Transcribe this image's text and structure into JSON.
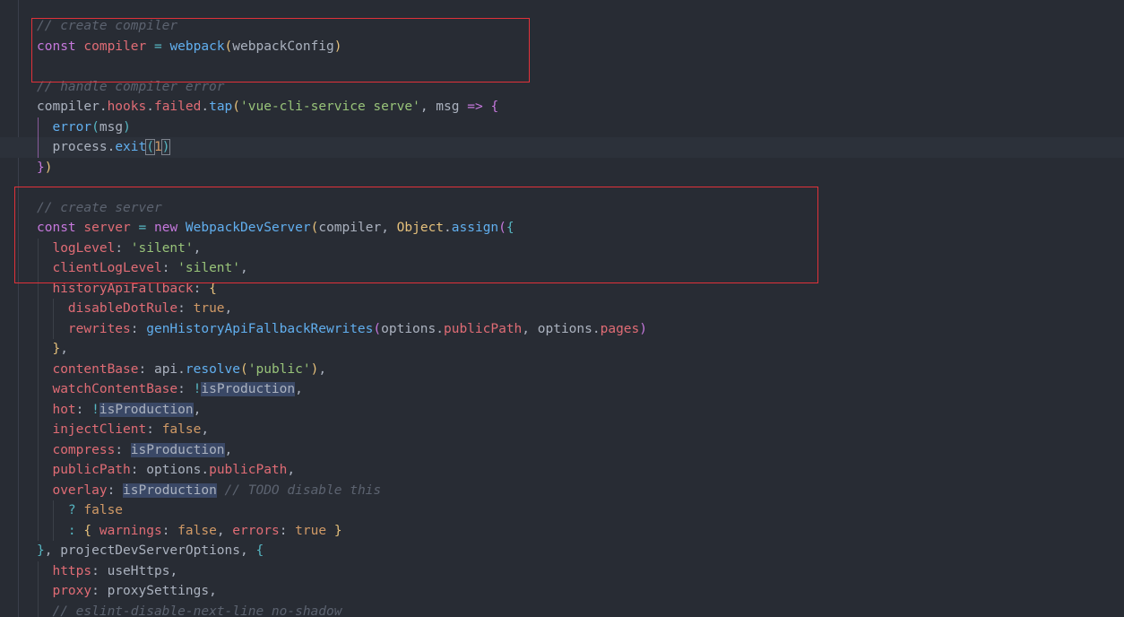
{
  "editor": {
    "lines": [
      {
        "t": [
          {
            "c": "cm",
            "v": "// create compiler"
          }
        ]
      },
      {
        "t": [
          {
            "c": "kw",
            "v": "const"
          },
          {
            "c": "pn",
            "v": " "
          },
          {
            "c": "vr",
            "v": "compiler"
          },
          {
            "c": "pn",
            "v": " "
          },
          {
            "c": "op",
            "v": "="
          },
          {
            "c": "pn",
            "v": " "
          },
          {
            "c": "fn",
            "v": "webpack"
          },
          {
            "c": "br1",
            "v": "("
          },
          {
            "c": "pn",
            "v": "webpackConfig"
          },
          {
            "c": "br1",
            "v": ")"
          }
        ]
      },
      {
        "t": []
      },
      {
        "t": [
          {
            "c": "cm",
            "v": "// handle compiler error"
          }
        ]
      },
      {
        "t": [
          {
            "c": "pn",
            "v": "compiler"
          },
          {
            "c": "pn",
            "v": "."
          },
          {
            "c": "vr",
            "v": "hooks"
          },
          {
            "c": "pn",
            "v": "."
          },
          {
            "c": "vr",
            "v": "failed"
          },
          {
            "c": "pn",
            "v": "."
          },
          {
            "c": "fn",
            "v": "tap"
          },
          {
            "c": "br1",
            "v": "("
          },
          {
            "c": "st",
            "v": "'vue-cli-service serve'"
          },
          {
            "c": "pn",
            "v": ", "
          },
          {
            "c": "pn",
            "v": "msg"
          },
          {
            "c": "pn",
            "v": " "
          },
          {
            "c": "kw",
            "v": "=>"
          },
          {
            "c": "pn",
            "v": " "
          },
          {
            "c": "br2",
            "v": "{"
          }
        ]
      },
      {
        "indent": 1,
        "t": [
          {
            "c": "fn",
            "v": "error"
          },
          {
            "c": "br3",
            "v": "("
          },
          {
            "c": "pn",
            "v": "msg"
          },
          {
            "c": "br3",
            "v": ")"
          }
        ]
      },
      {
        "indent": 1,
        "current": true,
        "t": [
          {
            "c": "pn",
            "v": "process"
          },
          {
            "c": "pn",
            "v": "."
          },
          {
            "c": "fn",
            "v": "exit"
          },
          {
            "c": "br3",
            "v": "("
          },
          {
            "c": "num",
            "v": "1"
          },
          {
            "c": "br3",
            "v": ")"
          }
        ]
      },
      {
        "t": [
          {
            "c": "br2",
            "v": "}"
          },
          {
            "c": "br1",
            "v": ")"
          }
        ]
      },
      {
        "t": []
      },
      {
        "t": [
          {
            "c": "cm",
            "v": "// create server"
          }
        ]
      },
      {
        "t": [
          {
            "c": "kw",
            "v": "const"
          },
          {
            "c": "pn",
            "v": " "
          },
          {
            "c": "vr",
            "v": "server"
          },
          {
            "c": "pn",
            "v": " "
          },
          {
            "c": "op",
            "v": "="
          },
          {
            "c": "pn",
            "v": " "
          },
          {
            "c": "kw",
            "v": "new"
          },
          {
            "c": "pn",
            "v": " "
          },
          {
            "c": "fn",
            "v": "WebpackDevServer"
          },
          {
            "c": "br1",
            "v": "("
          },
          {
            "c": "pn",
            "v": "compiler"
          },
          {
            "c": "pn",
            "v": ", "
          },
          {
            "c": "cl",
            "v": "Object"
          },
          {
            "c": "pn",
            "v": "."
          },
          {
            "c": "fn",
            "v": "assign"
          },
          {
            "c": "br2",
            "v": "("
          },
          {
            "c": "br3",
            "v": "{"
          }
        ]
      },
      {
        "indent": 1,
        "t": [
          {
            "c": "vr",
            "v": "logLevel"
          },
          {
            "c": "pn",
            "v": ": "
          },
          {
            "c": "st",
            "v": "'silent'"
          },
          {
            "c": "pn",
            "v": ","
          }
        ]
      },
      {
        "indent": 1,
        "t": [
          {
            "c": "vr",
            "v": "clientLogLevel"
          },
          {
            "c": "pn",
            "v": ": "
          },
          {
            "c": "st",
            "v": "'silent'"
          },
          {
            "c": "pn",
            "v": ","
          }
        ]
      },
      {
        "indent": 1,
        "t": [
          {
            "c": "vr",
            "v": "historyApiFallback"
          },
          {
            "c": "pn",
            "v": ": "
          },
          {
            "c": "br1",
            "v": "{"
          }
        ]
      },
      {
        "indent": 2,
        "t": [
          {
            "c": "vr",
            "v": "disableDotRule"
          },
          {
            "c": "pn",
            "v": ": "
          },
          {
            "c": "bool",
            "v": "true"
          },
          {
            "c": "pn",
            "v": ","
          }
        ]
      },
      {
        "indent": 2,
        "t": [
          {
            "c": "vr",
            "v": "rewrites"
          },
          {
            "c": "pn",
            "v": ": "
          },
          {
            "c": "fn",
            "v": "genHistoryApiFallbackRewrites"
          },
          {
            "c": "br2",
            "v": "("
          },
          {
            "c": "pn",
            "v": "options"
          },
          {
            "c": "pn",
            "v": "."
          },
          {
            "c": "vr",
            "v": "publicPath"
          },
          {
            "c": "pn",
            "v": ", "
          },
          {
            "c": "pn",
            "v": "options"
          },
          {
            "c": "pn",
            "v": "."
          },
          {
            "c": "vr",
            "v": "pages"
          },
          {
            "c": "br2",
            "v": ")"
          }
        ]
      },
      {
        "indent": 1,
        "t": [
          {
            "c": "br1",
            "v": "}"
          },
          {
            "c": "pn",
            "v": ","
          }
        ]
      },
      {
        "indent": 1,
        "t": [
          {
            "c": "vr",
            "v": "contentBase"
          },
          {
            "c": "pn",
            "v": ": "
          },
          {
            "c": "pn",
            "v": "api"
          },
          {
            "c": "pn",
            "v": "."
          },
          {
            "c": "fn",
            "v": "resolve"
          },
          {
            "c": "br1",
            "v": "("
          },
          {
            "c": "st",
            "v": "'public'"
          },
          {
            "c": "br1",
            "v": ")"
          },
          {
            "c": "pn",
            "v": ","
          }
        ]
      },
      {
        "indent": 1,
        "t": [
          {
            "c": "vr",
            "v": "watchContentBase"
          },
          {
            "c": "pn",
            "v": ": "
          },
          {
            "c": "op",
            "v": "!"
          },
          {
            "c": "pn hl",
            "v": "isProduction"
          },
          {
            "c": "pn",
            "v": ","
          }
        ]
      },
      {
        "indent": 1,
        "t": [
          {
            "c": "vr",
            "v": "hot"
          },
          {
            "c": "pn",
            "v": ": "
          },
          {
            "c": "op",
            "v": "!"
          },
          {
            "c": "pn hl",
            "v": "isProduction"
          },
          {
            "c": "pn",
            "v": ","
          }
        ]
      },
      {
        "indent": 1,
        "t": [
          {
            "c": "vr",
            "v": "injectClient"
          },
          {
            "c": "pn",
            "v": ": "
          },
          {
            "c": "bool",
            "v": "false"
          },
          {
            "c": "pn",
            "v": ","
          }
        ]
      },
      {
        "indent": 1,
        "t": [
          {
            "c": "vr",
            "v": "compress"
          },
          {
            "c": "pn",
            "v": ": "
          },
          {
            "c": "pn hl",
            "v": "isProduction"
          },
          {
            "c": "pn",
            "v": ","
          }
        ]
      },
      {
        "indent": 1,
        "t": [
          {
            "c": "vr",
            "v": "publicPath"
          },
          {
            "c": "pn",
            "v": ": "
          },
          {
            "c": "pn",
            "v": "options"
          },
          {
            "c": "pn",
            "v": "."
          },
          {
            "c": "vr",
            "v": "publicPath"
          },
          {
            "c": "pn",
            "v": ","
          }
        ]
      },
      {
        "indent": 1,
        "t": [
          {
            "c": "vr",
            "v": "overlay"
          },
          {
            "c": "pn",
            "v": ": "
          },
          {
            "c": "pn hl",
            "v": "isProduction"
          },
          {
            "c": "pn",
            "v": " "
          },
          {
            "c": "cm",
            "v": "// TODO disable this"
          }
        ]
      },
      {
        "indent": 2,
        "t": [
          {
            "c": "op",
            "v": "?"
          },
          {
            "c": "pn",
            "v": " "
          },
          {
            "c": "bool",
            "v": "false"
          }
        ]
      },
      {
        "indent": 2,
        "t": [
          {
            "c": "op",
            "v": ":"
          },
          {
            "c": "pn",
            "v": " "
          },
          {
            "c": "br1",
            "v": "{"
          },
          {
            "c": "pn",
            "v": " "
          },
          {
            "c": "vr",
            "v": "warnings"
          },
          {
            "c": "pn",
            "v": ": "
          },
          {
            "c": "bool",
            "v": "false"
          },
          {
            "c": "pn",
            "v": ", "
          },
          {
            "c": "vr",
            "v": "errors"
          },
          {
            "c": "pn",
            "v": ": "
          },
          {
            "c": "bool",
            "v": "true"
          },
          {
            "c": "pn",
            "v": " "
          },
          {
            "c": "br1",
            "v": "}"
          }
        ]
      },
      {
        "t": [
          {
            "c": "br3",
            "v": "}"
          },
          {
            "c": "pn",
            "v": ", "
          },
          {
            "c": "pn",
            "v": "projectDevServerOptions"
          },
          {
            "c": "pn",
            "v": ", "
          },
          {
            "c": "br3",
            "v": "{"
          }
        ]
      },
      {
        "indent": 1,
        "t": [
          {
            "c": "vr",
            "v": "https"
          },
          {
            "c": "pn",
            "v": ": "
          },
          {
            "c": "pn",
            "v": "useHttps"
          },
          {
            "c": "pn",
            "v": ","
          }
        ]
      },
      {
        "indent": 1,
        "t": [
          {
            "c": "vr",
            "v": "proxy"
          },
          {
            "c": "pn",
            "v": ": "
          },
          {
            "c": "pn",
            "v": "proxySettings"
          },
          {
            "c": "pn",
            "v": ","
          }
        ]
      },
      {
        "indent": 1,
        "t": [
          {
            "c": "cm",
            "v": "// eslint-disable-next-line no-shadow"
          }
        ]
      }
    ]
  }
}
